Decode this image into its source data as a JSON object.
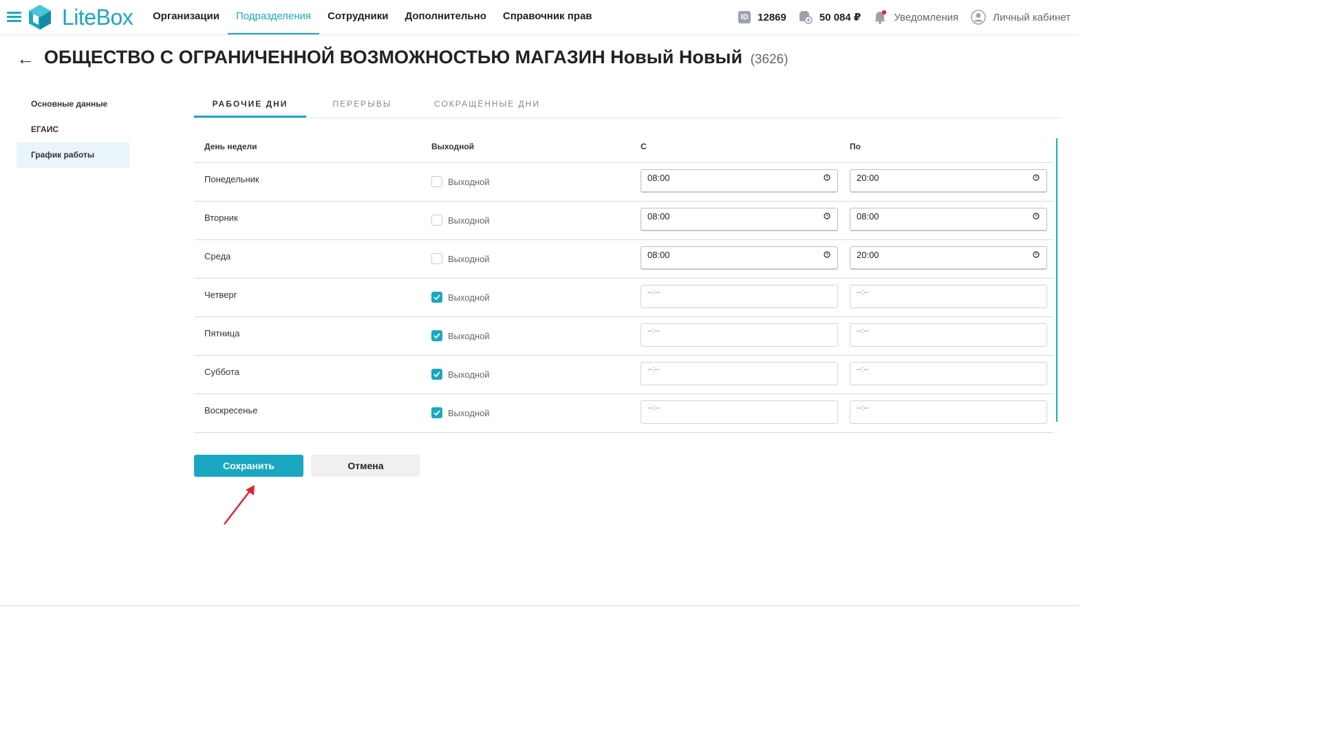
{
  "brand": {
    "name": "LiteBox",
    "color": "#1aa7c1"
  },
  "nav": {
    "items": [
      "Организации",
      "Подразделения",
      "Сотрудники",
      "Дополнительно",
      "Справочник прав"
    ],
    "active_index": 1
  },
  "header_info": {
    "id_badge": "ID",
    "id_value": "12869",
    "balance": "50 084 ₽",
    "notifications": "Уведомления",
    "account": "Личный кабинет"
  },
  "page": {
    "title": "ОБЩЕСТВО С ОГРАНИЧЕННОЙ ВОЗМОЖНОСТЬЮ МАГАЗИН Новый Новый",
    "count": "(3626)"
  },
  "side_menu": {
    "items": [
      "Основные данные",
      "ЕГАИС",
      "График работы"
    ],
    "active_index": 2
  },
  "tabs": {
    "items": [
      "РАБОЧИЕ ДНИ",
      "ПЕРЕРЫВЫ",
      "СОКРАЩЁННЫЕ ДНИ"
    ],
    "active_index": 0
  },
  "table": {
    "headers": {
      "day": "День недели",
      "dayoff": "Выходной",
      "from": "С",
      "to": "По"
    },
    "checkbox_label": "Выходной",
    "rows": [
      {
        "day": "Понедельник",
        "dayoff": false,
        "from": "08:00",
        "to": "20:00"
      },
      {
        "day": "Вторник",
        "dayoff": false,
        "from": "08:00",
        "to": "08:00"
      },
      {
        "day": "Среда",
        "dayoff": false,
        "from": "08:00",
        "to": "20:00"
      },
      {
        "day": "Четверг",
        "dayoff": true,
        "from": "--:--",
        "to": "--:--"
      },
      {
        "day": "Пятница",
        "dayoff": true,
        "from": "--:--",
        "to": "--:--"
      },
      {
        "day": "Суббота",
        "dayoff": true,
        "from": "--:--",
        "to": "--:--"
      },
      {
        "day": "Воскресенье",
        "dayoff": true,
        "from": "--:--",
        "to": "--:--"
      }
    ]
  },
  "actions": {
    "save": "Сохранить",
    "cancel": "Отмена"
  },
  "colors": {
    "accent": "#1aa7c1",
    "annotation_arrow": "#e8232a"
  }
}
